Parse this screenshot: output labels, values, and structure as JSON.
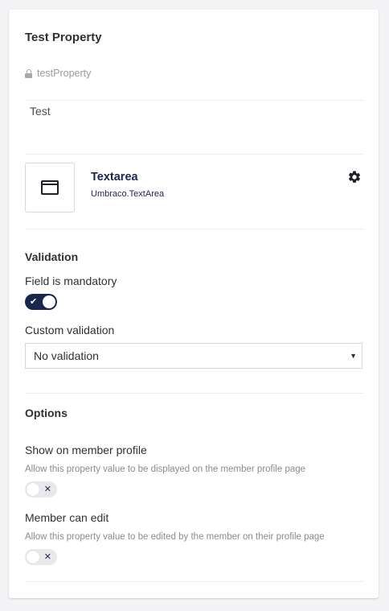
{
  "property": {
    "name": "Test Property",
    "alias": "testProperty",
    "description": "Test"
  },
  "editor": {
    "name": "Textarea",
    "alias": "Umbraco.TextArea",
    "icon": "window-icon",
    "settings_icon": "gear-icon"
  },
  "validation": {
    "title": "Validation",
    "mandatory_label": "Field is mandatory",
    "mandatory": true,
    "custom_label": "Custom validation",
    "custom_selected": "No validation"
  },
  "options": {
    "title": "Options",
    "show_on_profile": {
      "label": "Show on member profile",
      "help": "Allow this property value to be displayed on the member profile page",
      "enabled": false
    },
    "member_can_edit": {
      "label": "Member can edit",
      "help": "Allow this property value to be edited by the member on their profile page",
      "enabled": false
    }
  },
  "colors": {
    "accent": "#1b264f",
    "toggle_off": "#e9e9eb",
    "background": "#f3f3f5"
  }
}
